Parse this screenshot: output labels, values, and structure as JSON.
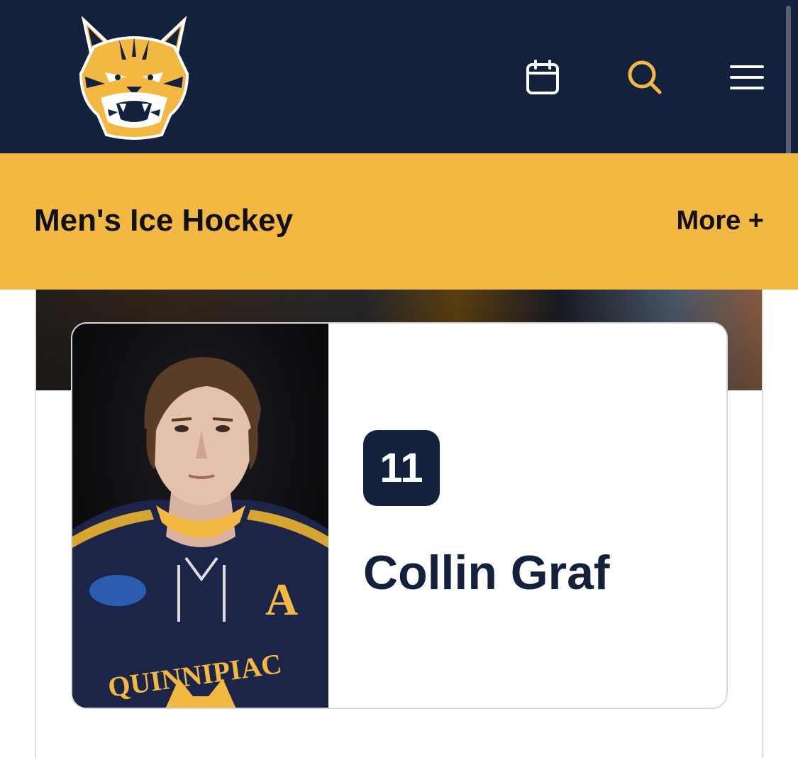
{
  "header": {
    "logo_name": "bobcat-logo",
    "calendar_icon": "calendar-icon",
    "search_icon": "search-icon",
    "menu_icon": "hamburger-menu-icon",
    "colors": {
      "navy": "#14213d",
      "gold": "#f2b842"
    }
  },
  "sport_bar": {
    "title": "Men's Ice Hockey",
    "more_label": "More +"
  },
  "player": {
    "number": "11",
    "name": "Collin Graf",
    "jersey_letter": "A",
    "jersey_text": "QUINNIPIAC"
  }
}
